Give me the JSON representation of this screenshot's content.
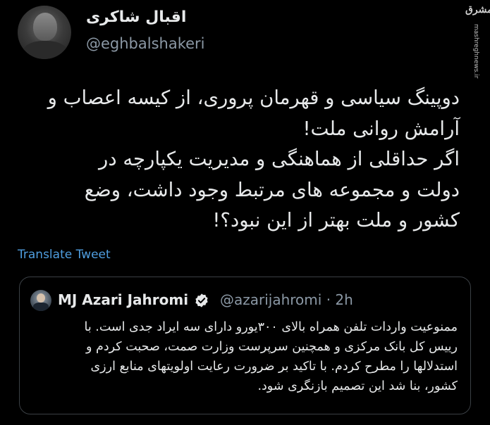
{
  "author": {
    "display_name": "اقبال شاکری",
    "handle": "@eghbalshakeri",
    "avatar": "profile-photo"
  },
  "watermark": {
    "logo_text": "مشرق",
    "site": "mashreghnews.ir"
  },
  "tweet": {
    "lines": [
      "دوپینگ سیاسی و قهرمان پروری، از کیسه اعصاب و",
      "آرامش روانی ملت!",
      "اگر حداقلی از هماهنگی و مدیریت یکپارچه در",
      "دولت و مجموعه های مرتبط وجود داشت، وضع",
      "کشور و ملت بهتر از این نبود؟!"
    ],
    "translate_label": "Translate Tweet"
  },
  "quoted_tweet": {
    "display_name": "MJ Azari Jahromi",
    "verified": true,
    "handle_time": "@azarijahromi · 2h",
    "lines": [
      "ممنوعیت واردات تلفن همراه بالای ۳۰۰یورو دارای سه ایراد جدی است. با",
      "رییس کل بانک مرکزی و همچنین سرپرست وزارت صمت، صحبت کردم و",
      "استدلالها را مطرح کردم. با تاکید بر ضرورت رعایت اولویتهای منابع ارزی",
      "کشور، بنا شد این تصمیم بازنگری شود."
    ]
  },
  "colors": {
    "background": "#000000",
    "text": "#e7e9ea",
    "muted": "#8b98a5",
    "link": "#4f9ee0",
    "border": "#3b4045"
  }
}
